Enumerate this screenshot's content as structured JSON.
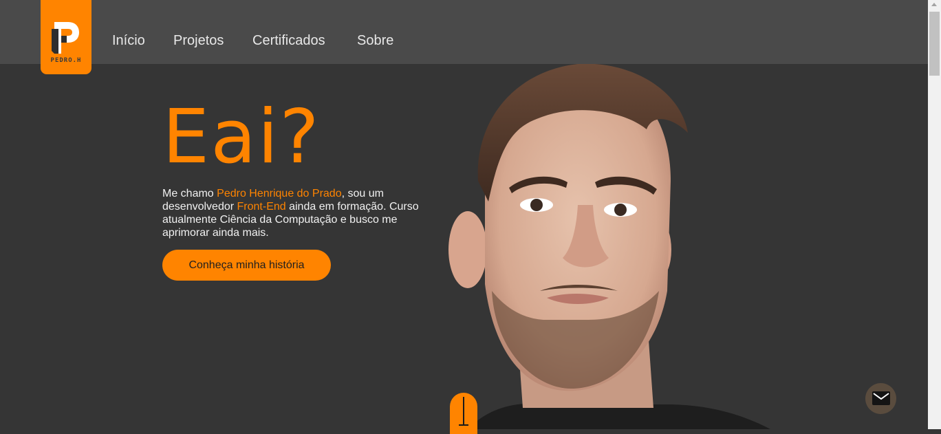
{
  "logo": {
    "text": "PEDRO.H",
    "icon": "p-monogram-logo"
  },
  "nav": {
    "items": [
      {
        "label": "Início"
      },
      {
        "label": "Projetos"
      },
      {
        "label": "Certificados"
      },
      {
        "label": "Sobre"
      }
    ]
  },
  "hero": {
    "title": "Eai?",
    "intro_1": "Me chamo ",
    "name": "Pedro Henrique do Prado",
    "intro_2": ", sou um desenvolvedor ",
    "role": "Front-End",
    "intro_3": " ainda em formação. Curso atualmente Ciência da Computação e busco me aprimorar ainda mais.",
    "cta_label": "Conheça minha história"
  },
  "photo": {
    "description_icon": "portrait-photo"
  },
  "widgets": {
    "mail_icon": "envelope-icon",
    "scroll_icon": "scroll-down-indicator"
  },
  "colors": {
    "accent": "#ff8400",
    "navbar": "#4a4a4a",
    "background": "#353535",
    "mail_button": "#5a4c3e"
  }
}
